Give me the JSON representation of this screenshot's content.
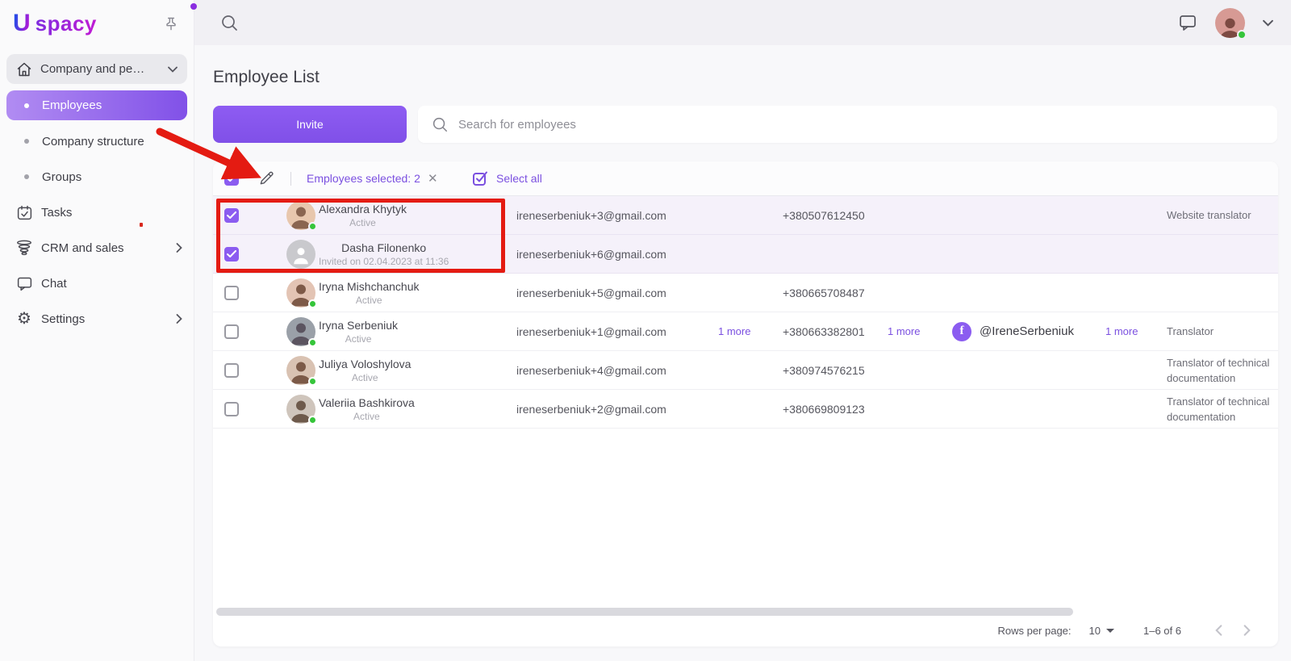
{
  "brand": {
    "logo_u": "U",
    "logo_rest": "spacy"
  },
  "icons": {
    "gear": "⚙",
    "close": "✕",
    "facebook_glyph": "f"
  },
  "sidebar": {
    "workspace": {
      "label": "Company and pe…"
    },
    "items": [
      {
        "label": "Employees",
        "active": true
      },
      {
        "label": "Company structure"
      },
      {
        "label": "Groups"
      },
      {
        "label": "Tasks"
      },
      {
        "label": "CRM and sales"
      },
      {
        "label": "Chat"
      },
      {
        "label": "Settings"
      }
    ]
  },
  "header": {
    "page_title": "Employee List",
    "invite_label": "Invite",
    "search_placeholder": "Search for employees"
  },
  "selection_bar": {
    "selected_text": "Employees selected: 2",
    "select_all_label": "Select all"
  },
  "table": {
    "rows": [
      {
        "name": "Alexandra Khytyk",
        "status": "Active",
        "email": "ireneserbeniuk+3@gmail.com",
        "phone": "+380507612450",
        "position": "Website translator",
        "selected": true
      },
      {
        "name": "Dasha Filonenko",
        "status": "Invited on 02.04.2023 at 11:36",
        "email": "ireneserbeniuk+6@gmail.com",
        "selected": true
      },
      {
        "name": "Iryna Mishchanchuk",
        "status": "Active",
        "email": "ireneserbeniuk+5@gmail.com",
        "phone": "+380665708487"
      },
      {
        "name": "Iryna Serbeniuk",
        "status": "Active",
        "email": "ireneserbeniuk+1@gmail.com",
        "email_more": "1 more",
        "phone": "+380663382801",
        "phone_more": "1 more",
        "social_handle": "@IreneSerbeniuk",
        "social_more": "1 more",
        "position": "Translator"
      },
      {
        "name": "Juliya Voloshylova",
        "status": "Active",
        "email": "ireneserbeniuk+4@gmail.com",
        "phone": "+380974576215",
        "position": "Translator of technical documentation"
      },
      {
        "name": "Valeriia Bashkirova",
        "status": "Active",
        "email": "ireneserbeniuk+2@gmail.com",
        "phone": "+380669809123",
        "position": "Translator of technical documentation"
      }
    ]
  },
  "footer": {
    "rows_per_page_label": "Rows per page:",
    "rows_per_page_value": "10",
    "range_text": "1–6 of 6"
  },
  "colors": {
    "accent": "#8151e8",
    "selected_row_bg": "#f5f1fa",
    "annotation_red": "#e41b12",
    "online_green": "#35c53a"
  }
}
